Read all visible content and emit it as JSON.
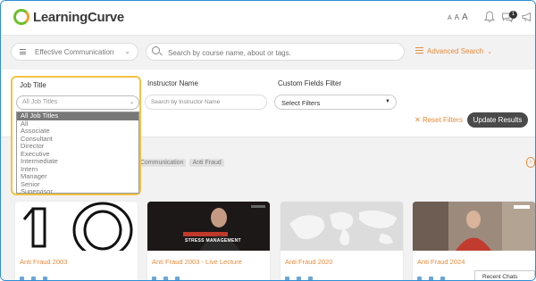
{
  "header": {
    "logo_text": "LearningCurve",
    "font_sizes": [
      "A",
      "A",
      "A"
    ],
    "notification_count": "1"
  },
  "search": {
    "course_select_value": "Effective Communication",
    "placeholder": "Search by course name, about or tags.",
    "advanced_label": "Advanced Search"
  },
  "filters": {
    "job_title_label": "Job Title",
    "job_title_placeholder": "All Job Titles",
    "job_title_options": [
      "All Job Titles",
      "All",
      "Associate",
      "Consultant",
      "Director",
      "Executive",
      "Intermediate",
      "Intern",
      "Manager",
      "Senior",
      "Supervisor"
    ],
    "selected_index": 0,
    "instructor_label": "Instructor Name",
    "instructor_placeholder": "Search by Instructor Name",
    "custom_label": "Custom Fields Filter",
    "custom_value": "Select Filters",
    "reset_label": "Reset Filters",
    "update_label": "Update Results"
  },
  "tags": [
    "e Communication",
    "Anti Fraud"
  ],
  "cards": [
    {
      "title": "Anti Fraud 2003"
    },
    {
      "title": "Anti Fraud 2003 - Live Lecture",
      "thumb_caption": "STRESS MANAGEMENT"
    },
    {
      "title": "Anti Fraud 2020"
    },
    {
      "title": "Anti Fraud 2024"
    }
  ],
  "recent_chats": "Recent Chats",
  "colors": {
    "accent": "#e88a3a",
    "highlight": "#f5c242",
    "border": "#2f8fd6"
  }
}
